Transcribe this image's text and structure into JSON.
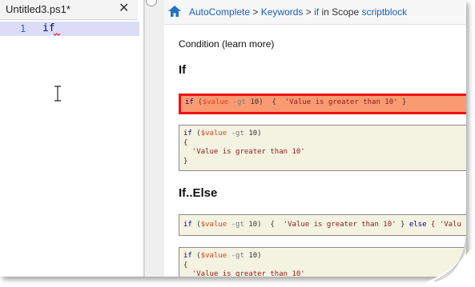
{
  "editor": {
    "tab_title": "Untitled3.ps1*",
    "close_glyph": "✕",
    "lines": [
      {
        "number": "1",
        "code": "if"
      }
    ]
  },
  "help": {
    "breadcrumb": {
      "icon": "home-icon",
      "part1": "AutoComplete",
      "sep1": " > ",
      "part2": "Keywords",
      "sep2": " > ",
      "part3": "if",
      "mid": " in Scope ",
      "part4": "scriptblock"
    },
    "condition_text": "Condition (learn more)",
    "sections": [
      {
        "heading": "If",
        "code_oneline": {
          "kw": "if",
          "p1": " (",
          "var": "$value",
          "sp1": " ",
          "op": "-gt",
          "sp2": " ",
          "num": "10",
          "p2": ")  {  ",
          "str": "'Value is greater than 10'",
          "p3": " }"
        },
        "code_multi": {
          "l1": {
            "kw": "if",
            "p1": " (",
            "var": "$value",
            "sp1": " ",
            "op": "-gt",
            "sp2": " ",
            "num": "10",
            "p2": ")"
          },
          "l2": "{",
          "l3": "  'Value is greater than 10'",
          "l4": "}"
        }
      },
      {
        "heading": "If..Else",
        "code_oneline": {
          "kw": "if",
          "p1": " (",
          "var": "$value",
          "sp1": " ",
          "op": "-gt",
          "sp2": " ",
          "num": "10",
          "p2": ")  {  ",
          "str": "'Value is greater than 10'",
          "p3": " } ",
          "kw2": "else",
          "p4": " { 'Valu"
        },
        "code_multi": {
          "l1": {
            "kw": "if",
            "p1": " (",
            "var": "$value",
            "sp1": " ",
            "op": "-gt",
            "sp2": " ",
            "num": "10",
            "p2": ")"
          },
          "l2": "{",
          "l3": "  'Value is greater than 10'"
        }
      }
    ]
  },
  "colors": {
    "highlight_fill": "#fa9a73",
    "highlight_border": "#ee1111",
    "code_bg": "#f4f2e1",
    "link": "#1a5fb4",
    "keyword": "#00008b",
    "variable": "#e0401e"
  }
}
